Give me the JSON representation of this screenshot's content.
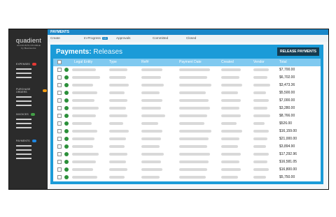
{
  "brand": {
    "name": "quadient",
    "sub1": "ACCOUNTS PAYABLE",
    "sub2": "by Beanworks"
  },
  "sidebar": {
    "sections": [
      {
        "label": "EXPENSES",
        "color": "#e53935"
      },
      {
        "label": "PURCHASE ORDERS",
        "color": "#f39c12"
      },
      {
        "label": "INVOICES",
        "color": "#43a047"
      },
      {
        "label": "PAYMENTS",
        "color": "#1e88e5"
      }
    ]
  },
  "header": {
    "title": "PAYMENTS"
  },
  "nav": {
    "items": [
      {
        "label": "Create"
      },
      {
        "label": "In-Progress",
        "badge": "13"
      },
      {
        "label": "Approvals"
      },
      {
        "label": "Committed"
      },
      {
        "label": "Closed"
      }
    ]
  },
  "panel": {
    "title_bold": "Payments:",
    "title_light": "Releases",
    "release_button": "RELEASE PAYMENTS"
  },
  "table": {
    "columns": [
      "Legal Entity",
      "Type",
      "Ref#",
      "Payment Date",
      "Created",
      "Vendor",
      "Total"
    ],
    "totals": [
      "$7,700.00",
      "$6,702.00",
      "$3,473.36",
      "$5,500.00",
      "$7,000.00",
      "$3,280.00",
      "$8,766.00",
      "$526.00",
      "$16,159.00",
      "$21,000.00",
      "$3,894.90",
      "$17,292.96",
      "$16,581.05",
      "$16,800.00",
      "$5,750.00"
    ],
    "status_color": "#2c8f3a",
    "placeholder_color": "#d9d9d9"
  }
}
